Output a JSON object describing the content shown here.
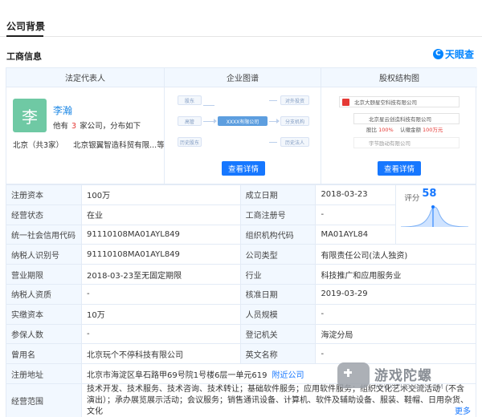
{
  "tabs": {
    "active": "公司背景"
  },
  "section": {
    "title": "工商信息",
    "brand": "天眼查",
    "brand_icon_glyph": "C"
  },
  "cards": {
    "legal_rep": {
      "header": "法定代表人",
      "avatar_char": "李",
      "name": "李瀚",
      "sub_prefix": "他有",
      "sub_count": "3",
      "sub_suffix": "家公司，分布如下",
      "region": "北京（共3家）",
      "company": "北京银翼智造科贸有限...等"
    },
    "map": {
      "header": "企业图谱",
      "nodes": [
        "股东",
        "高管",
        "历史股东",
        "XXXX有限公司",
        "对外投资",
        "分支机构",
        "历史法人"
      ],
      "button": "查看详情"
    },
    "equity": {
      "header": "股权结构图",
      "top_company": "北京大颐星空科技有限公司",
      "child_company": "北京星云创造科技有限公司",
      "ratio_label": "股比",
      "ratio_value": "100%",
      "amount_label": "认缴金额",
      "amount_value": "100万元",
      "third_company": "宇节励动有限公司",
      "button": "查看详情"
    }
  },
  "info_rows": [
    {
      "l1": "注册资本",
      "v1": "100万",
      "l2": "成立日期",
      "v2": "2018-03-23"
    },
    {
      "l1": "经营状态",
      "v1": "在业",
      "l2": "工商注册号",
      "v2": "-"
    },
    {
      "l1": "统一社会信用代码",
      "v1": "91110108MA01AYL849",
      "l2": "组织机构代码",
      "v2": "MA01AYL84"
    },
    {
      "l1": "纳税人识别号",
      "v1": "91110108MA01AYL849",
      "l2": "公司类型",
      "v2": "有限责任公司(法人独资)"
    },
    {
      "l1": "营业期限",
      "v1": "2018-03-23至无固定期限",
      "l2": "行业",
      "v2": "科技推广和应用服务业"
    },
    {
      "l1": "纳税人资质",
      "v1": "-",
      "l2": "核准日期",
      "v2": "2019-03-29"
    },
    {
      "l1": "实缴资本",
      "v1": "10万",
      "l2": "人员规模",
      "v2": "-"
    },
    {
      "l1": "参保人数",
      "v1": "-",
      "l2": "登记机关",
      "v2": "海淀分局"
    },
    {
      "l1": "曾用名",
      "v1": "北京玩个不停科技有限公司",
      "l2": "英文名称",
      "v2": "-"
    }
  ],
  "score": {
    "label": "评分",
    "value": 58
  },
  "address": {
    "label": "注册地址",
    "value": "北京市海淀区阜石路甲69号院1号楼6层一单元619",
    "link": "附近公司"
  },
  "scope": {
    "label": "经营范围",
    "text": "技术开发、技术服务、技术咨询、技术转让；基础软件服务；应用软件服务；组织文化艺术交流活动（不含演出）；承办展览展示活动；会议服务；销售通讯设备、计算机、软件及辅助设备、服装、鞋帽、日用杂货、文化",
    "more": "更多"
  },
  "watermark": {
    "text": "游戏陀螺",
    "sub": "YOUXITUOLUO.COM"
  },
  "colors": {
    "accent": "#1677ff",
    "header_bg": "#f2f8ff",
    "border": "#e3ebf6",
    "avatar": "#6fc9a4",
    "count_red": "#e53935"
  }
}
